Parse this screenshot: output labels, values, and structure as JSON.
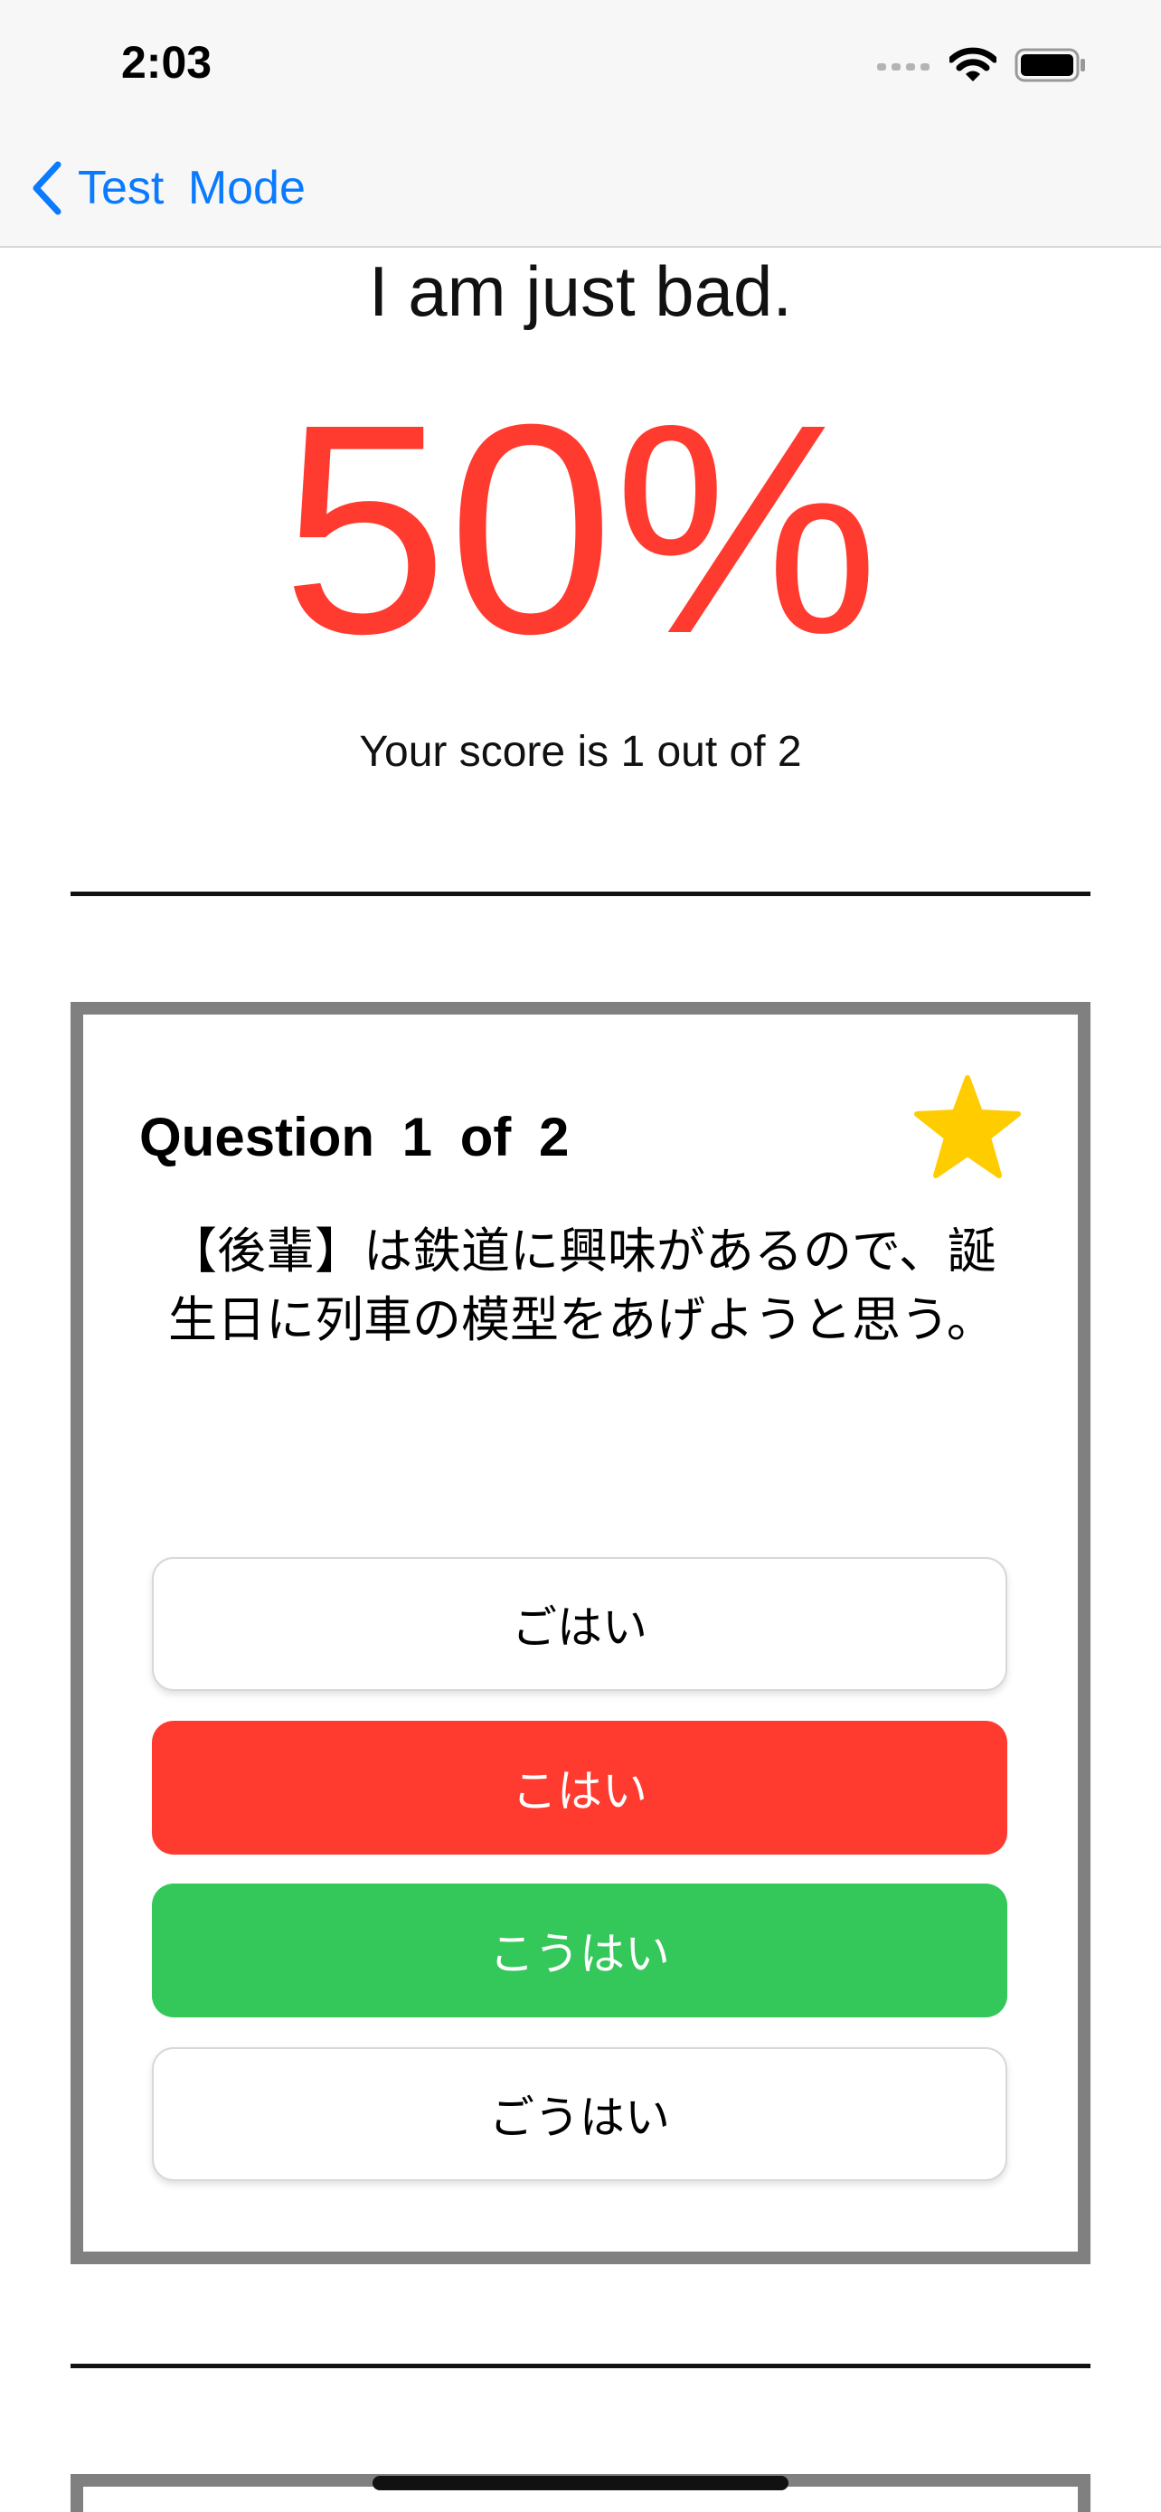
{
  "status_bar": {
    "time": "2:03",
    "icons": [
      "cellular-signal-icon",
      "wifi-icon",
      "battery-icon"
    ]
  },
  "nav": {
    "back_label": "Test  Mode",
    "back_icon": "chevron-left-icon",
    "accent_color": "#0a7aff"
  },
  "result": {
    "message": "I am just bad.",
    "percent": "50%",
    "summary": "Your score is 1 out of 2",
    "percent_color": "#ff3b30"
  },
  "question": {
    "number_label": "Question 1 of 2",
    "favorite_icon": "star-icon",
    "favorited": true,
    "star_color": "#ffcc00",
    "text": "【後輩】は鉄道に興味があるので、誕生日に列車の模型をあげようと思う。",
    "answers": [
      {
        "label": "ごはい",
        "state": "unselected"
      },
      {
        "label": "こはい",
        "state": "wrong"
      },
      {
        "label": "こうはい",
        "state": "correct"
      },
      {
        "label": "ごうはい",
        "state": "unselected"
      }
    ]
  },
  "colors": {
    "wrong": "#ff3b30",
    "correct": "#34c759",
    "card_border": "#808080"
  }
}
